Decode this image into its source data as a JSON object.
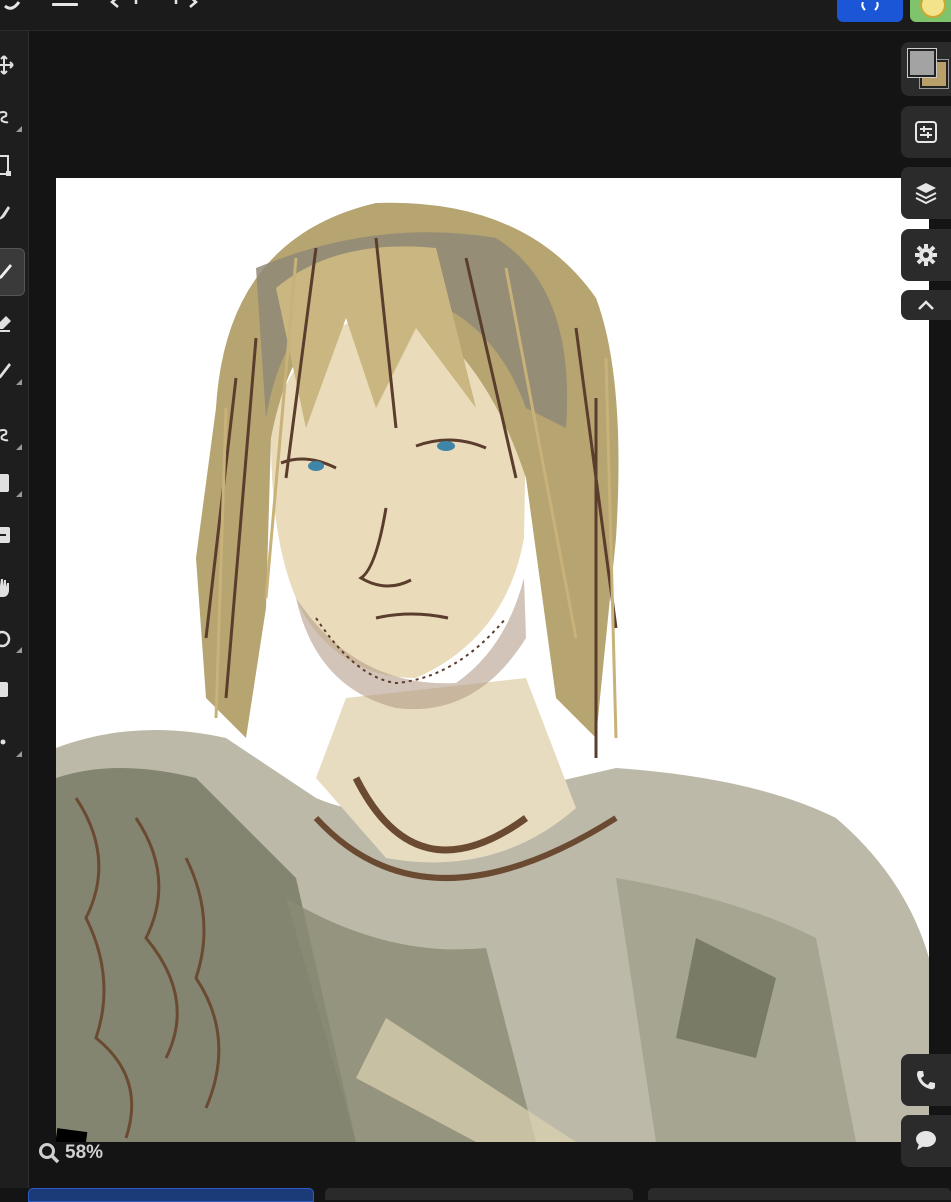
{
  "zoom": {
    "value": "58%"
  },
  "colors": {
    "foreground": "#a3a3a3",
    "background": "#b9a06a",
    "share_button": "#1a56d6",
    "canvas": "#ffffff",
    "ui_dark": "#141414"
  },
  "icons": {
    "top": [
      "back-icon",
      "menu-icon",
      "undo-icon",
      "redo-icon",
      "share-icon",
      "avatar"
    ],
    "tools": [
      "move-icon",
      "lasso-icon",
      "transform-icon",
      "smudge-icon",
      "brush-icon",
      "eraser-icon",
      "pen-icon",
      "selection-icon",
      "rectangle-icon",
      "add-layer-icon",
      "hand-icon",
      "rotate-icon",
      "fill-icon",
      "dot-icon"
    ],
    "right": [
      "color-swatch",
      "adjustments-icon",
      "layers-icon",
      "settings-icon",
      "chevron-up-icon",
      "phone-icon",
      "chat-icon"
    ]
  }
}
